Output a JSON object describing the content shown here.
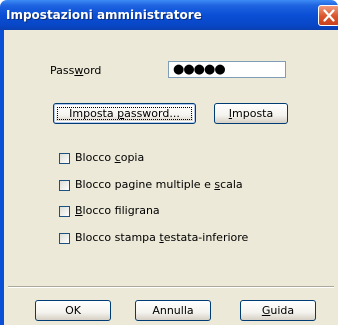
{
  "window": {
    "title": "Impostazioni amministratore"
  },
  "password": {
    "label_before": "Pass",
    "label_accel": "w",
    "label_after": "ord",
    "value": "●●●●●"
  },
  "buttons": {
    "set_password_before": "Imposta ",
    "set_password_accel": "p",
    "set_password_after": "assword...",
    "set_accel": "I",
    "set_after": "mposta"
  },
  "checkboxes": [
    {
      "before": "Blocco ",
      "accel": "c",
      "after": "opia",
      "checked": false
    },
    {
      "before": "Blocco pagine multiple e ",
      "accel": "s",
      "after": "cala",
      "checked": false
    },
    {
      "before": "",
      "accel": "B",
      "after": "locco filigrana",
      "checked": false
    },
    {
      "before": "Blocco stampa ",
      "accel": "t",
      "after": "estata-inferiore",
      "checked": false
    }
  ],
  "footer": {
    "ok": "OK",
    "cancel": "Annulla",
    "guide_accel": "G",
    "guide_after": "uida"
  },
  "colors": {
    "titlebar": "#0a4fd6",
    "dialog_bg": "#ece9d8",
    "close_button": "#d9542b"
  }
}
